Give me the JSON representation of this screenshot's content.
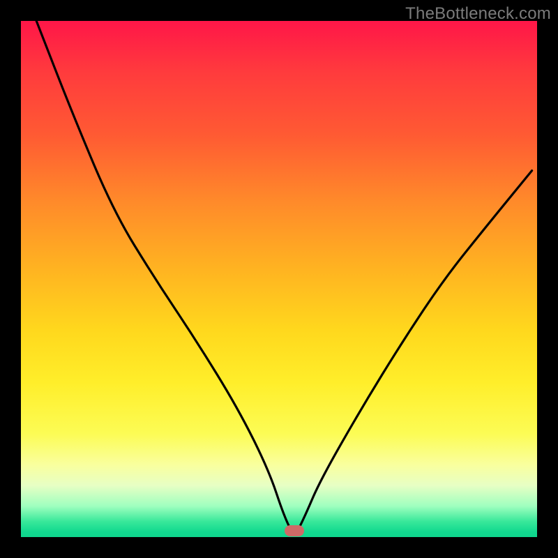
{
  "watermark": "TheBottleneck.com",
  "colors": {
    "frame_bg": "#000000",
    "curve": "#000000",
    "marker": "#cf6a67",
    "gradient_top": "#ff1648",
    "gradient_bottom": "#0fd68d"
  },
  "chart_data": {
    "type": "line",
    "title": "",
    "xlabel": "",
    "ylabel": "",
    "xlim": [
      0,
      100
    ],
    "ylim": [
      0,
      100
    ],
    "note": "V-shaped bottleneck curve over a red→green heat gradient. Minimum (≈0) at x≈53; marker placed at the minimum. Apparent slope break on the left branch near x≈18.",
    "marker_x": 53,
    "series": [
      {
        "name": "bottleneck-curve",
        "x": [
          3,
          10,
          18,
          26,
          34,
          42,
          48,
          51,
          53,
          55,
          58,
          66,
          74,
          82,
          90,
          99
        ],
        "values": [
          100,
          82,
          63,
          50,
          38,
          25,
          13,
          4,
          0,
          4,
          11,
          25,
          38,
          50,
          60,
          71
        ]
      }
    ]
  }
}
